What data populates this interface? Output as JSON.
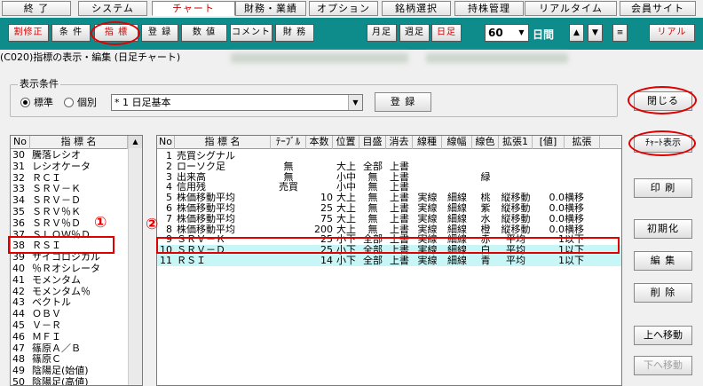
{
  "menu_tabs": [
    "終 了",
    "システム",
    "チャート",
    "財務・業績",
    "オプション",
    "銘柄選択",
    "持株管理",
    "リアルタイム",
    "会員サイト"
  ],
  "toolbar": {
    "buttons": [
      "割修正",
      "条 件",
      "指 標",
      "登 録",
      "数 値",
      "コメント",
      "財 務"
    ],
    "right_buttons": [
      "月足",
      "週足",
      "日足"
    ],
    "period_value": "60",
    "period_unit": "日間",
    "real_label": "リアル"
  },
  "window_title": "(C020)指標の表示・編集 (日足チャート)",
  "display_conditions": {
    "label": "表示条件",
    "radio_standard": "標準",
    "radio_individual": "個別",
    "combo_value": "* 1 日足基本",
    "register_button": "登 録"
  },
  "left_list": {
    "headers": [
      "No",
      "指 標 名"
    ],
    "items": [
      [
        "30",
        "騰落レシオ"
      ],
      [
        "31",
        "レシオケータ"
      ],
      [
        "32",
        "ＲＣＩ"
      ],
      [
        "33",
        "ＳＲＶ－Ｋ"
      ],
      [
        "34",
        "ＳＲＶ－Ｄ"
      ],
      [
        "35",
        "ＳＲＶ％Ｋ"
      ],
      [
        "36",
        "ＳＲＶ％Ｄ"
      ],
      [
        "37",
        "ＳＬＯＷ％Ｄ"
      ],
      [
        "38",
        "ＲＳＩ"
      ],
      [
        "39",
        "サイコロジカル"
      ],
      [
        "40",
        "％Ｒオシレータ"
      ],
      [
        "41",
        "モメンタム"
      ],
      [
        "42",
        "モメンタム％"
      ],
      [
        "43",
        "ベクトル"
      ],
      [
        "44",
        "ＯＢＶ"
      ],
      [
        "45",
        "Ｖ－Ｒ"
      ],
      [
        "46",
        "ＭＦＩ"
      ],
      [
        "47",
        "篠原Ａ／Ｂ"
      ],
      [
        "48",
        "篠原Ｃ"
      ],
      [
        "49",
        "陰陽足(始値)"
      ],
      [
        "50",
        "陰陽足(高値)"
      ]
    ]
  },
  "right_table": {
    "headers": [
      "No",
      "指 標 名",
      "ﾃｰﾌﾞﾙ",
      "本数",
      "位置",
      "目盛",
      "消去",
      "線種",
      "線幅",
      "線色",
      "拡張1",
      "[値]",
      "拡張"
    ],
    "rows": [
      [
        "1",
        "売買シグナル",
        "",
        "",
        "",
        "",
        "",
        "",
        "",
        "",
        "",
        "",
        ""
      ],
      [
        "2",
        "ローソク足",
        "無",
        "",
        "大上",
        "全部",
        "上書",
        "",
        "",
        "",
        "",
        "",
        ""
      ],
      [
        "3",
        "出来高",
        "無",
        "",
        "小中",
        "無",
        "上書",
        "",
        "",
        "緑",
        "",
        "",
        ""
      ],
      [
        "4",
        "信用残",
        "売買",
        "",
        "小中",
        "無",
        "上書",
        "",
        "",
        "",
        "",
        "",
        ""
      ],
      [
        "5",
        "株価移動平均",
        "",
        "10",
        "大上",
        "無",
        "上書",
        "実線",
        "細線",
        "桃",
        "縦移動",
        "0.0",
        "横移"
      ],
      [
        "6",
        "株価移動平均",
        "",
        "25",
        "大上",
        "無",
        "上書",
        "実線",
        "細線",
        "紫",
        "縦移動",
        "0.0",
        "横移"
      ],
      [
        "7",
        "株価移動平均",
        "",
        "75",
        "大上",
        "無",
        "上書",
        "実線",
        "細線",
        "水",
        "縦移動",
        "0.0",
        "横移"
      ],
      [
        "8",
        "株価移動平均",
        "",
        "200",
        "大上",
        "無",
        "上書",
        "実線",
        "細線",
        "橙",
        "縦移動",
        "0.0",
        "横移"
      ],
      [
        "9",
        "ＳＲＶ－Ｋ",
        "",
        "25",
        "小下",
        "全部",
        "上書",
        "実線",
        "細線",
        "赤",
        "平均",
        "1",
        "以下"
      ],
      [
        "10",
        "ＳＲＶ－Ｄ",
        "",
        "25",
        "小下",
        "全部",
        "上書",
        "実線",
        "細線",
        "白",
        "平均",
        "1",
        "以下"
      ],
      [
        "11",
        "ＲＳＩ",
        "",
        "14",
        "小下",
        "全部",
        "上書",
        "実線",
        "細線",
        "青",
        "平均",
        "1",
        "以下"
      ]
    ]
  },
  "side_buttons": {
    "close": "閉じる",
    "chart_display": "ﾁｬｰﾄ表示",
    "print": "印 刷",
    "init": "初期化",
    "edit": "編 集",
    "delete": "削 除",
    "move_up": "上へ移動",
    "move_down": "下へ移動"
  },
  "annotations": [
    "①",
    "②"
  ],
  "colors": {
    "teal_bar": "#0e8c8c",
    "annotation_red": "#e00000",
    "highlight_row": "#c8f5f5"
  }
}
